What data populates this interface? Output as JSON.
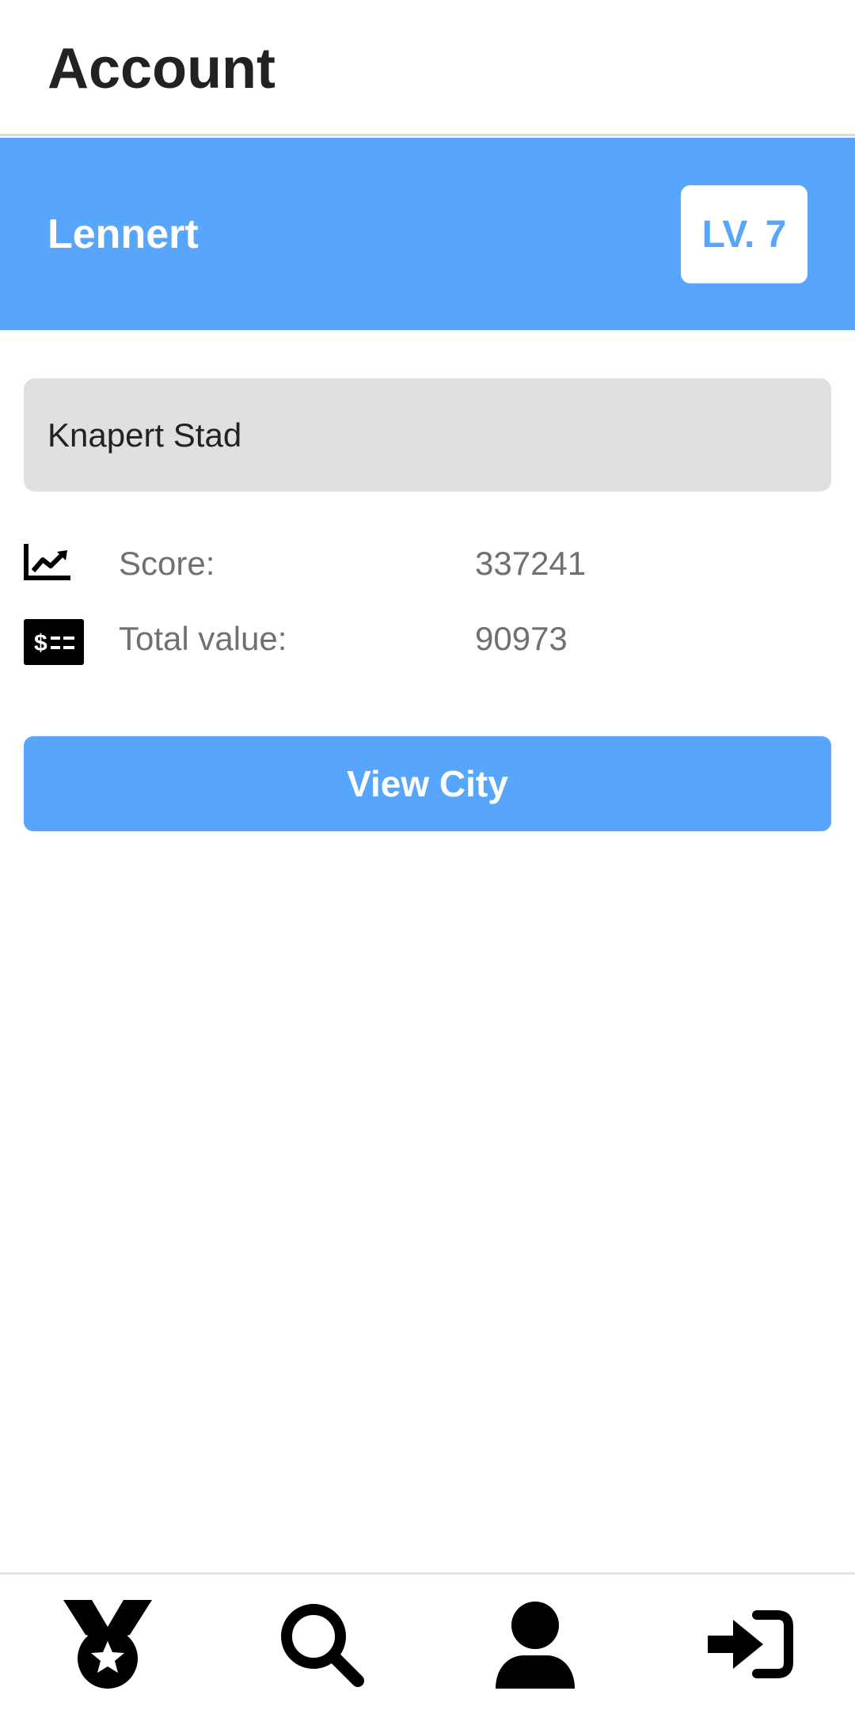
{
  "header": {
    "title": "Account"
  },
  "profile": {
    "username": "Lennert",
    "level_label": "LV. 7"
  },
  "city": {
    "name": "Knapert Stad"
  },
  "stats": [
    {
      "icon": "chart-line-icon",
      "label": "Score:",
      "value": "337241"
    },
    {
      "icon": "money-check-icon",
      "label": "Total value:",
      "value": "90973"
    }
  ],
  "actions": {
    "view_city_label": "View City"
  },
  "bottom_nav": {
    "items": [
      {
        "icon": "medal-icon"
      },
      {
        "icon": "search-icon"
      },
      {
        "icon": "user-icon"
      },
      {
        "icon": "sign-in-icon"
      }
    ]
  },
  "colors": {
    "accent": "#58a6fb",
    "field_bg": "#e0e0e0",
    "text_dark": "#222222",
    "text_muted": "#707070"
  }
}
